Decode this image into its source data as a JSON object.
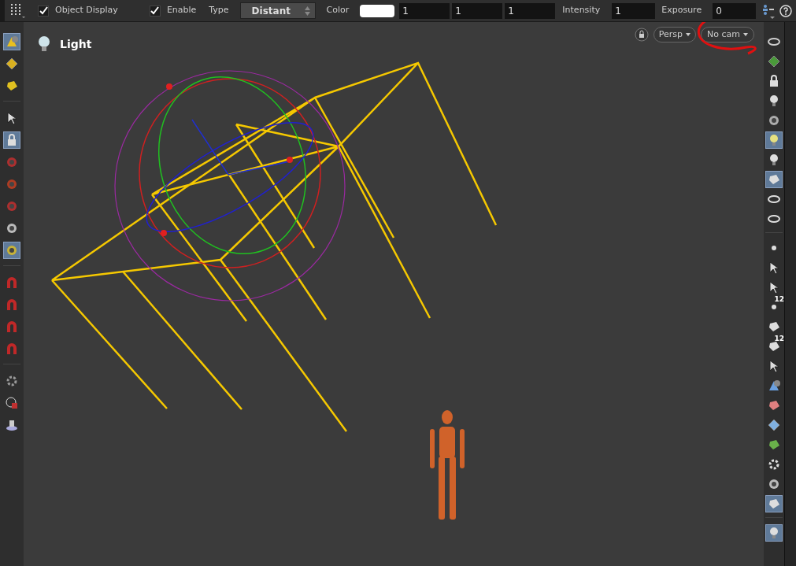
{
  "toolbar": {
    "object_display": {
      "label": "Object Display",
      "checked": true
    },
    "enable": {
      "label": "Enable",
      "checked": true
    },
    "type": {
      "label": "Type",
      "value": "Distant"
    },
    "color": {
      "label": "Color",
      "values": [
        "1",
        "1",
        "1"
      ]
    },
    "intensity": {
      "label": "Intensity",
      "value": "1"
    },
    "exposure": {
      "label": "Exposure",
      "value": "0"
    }
  },
  "viewport": {
    "title": "Light",
    "projection": "Persp",
    "camera": "No cam"
  },
  "left_tools": [
    [
      {
        "selected": true
      },
      {
        "selected": false
      },
      {
        "selected": false
      }
    ],
    [
      {
        "selected": false
      },
      {
        "selected": true
      },
      {
        "selected": false
      },
      {
        "selected": false
      },
      {
        "selected": false
      },
      {
        "selected": false
      },
      {
        "selected": true
      }
    ],
    [
      {
        "selected": false
      },
      {
        "selected": false
      },
      {
        "selected": false
      },
      {
        "selected": false
      }
    ],
    [
      {
        "selected": false
      },
      {
        "selected": false
      },
      {
        "selected": false
      }
    ]
  ],
  "right_tools": [
    [
      {
        "selected": false
      },
      {
        "selected": false
      },
      {
        "selected": false
      },
      {
        "selected": false
      },
      {
        "selected": false
      },
      {
        "selected": true
      },
      {
        "selected": false
      },
      {
        "selected": true
      },
      {
        "selected": false
      },
      {
        "selected": false
      }
    ],
    [
      {
        "selected": false
      },
      {
        "selected": false
      },
      {
        "selected": false
      },
      {
        "selected": false,
        "badge": "12"
      },
      {
        "selected": false
      },
      {
        "selected": false,
        "badge": "12"
      },
      {
        "selected": false
      },
      {
        "selected": false
      },
      {
        "selected": false
      },
      {
        "selected": false
      },
      {
        "selected": false
      },
      {
        "selected": false
      },
      {
        "selected": false
      },
      {
        "selected": true
      }
    ],
    [
      {
        "selected": true
      }
    ]
  ]
}
